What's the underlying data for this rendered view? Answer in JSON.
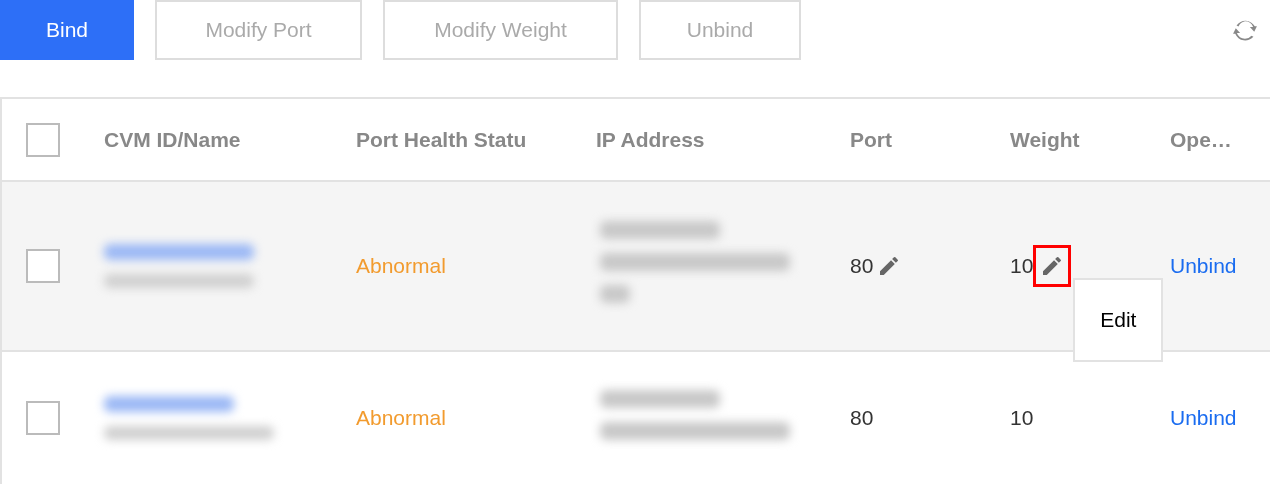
{
  "toolbar": {
    "buttons": [
      {
        "label": "Bind",
        "kind": "primary",
        "disabled": false
      },
      {
        "label": "Modify Port",
        "kind": "default",
        "disabled": true
      },
      {
        "label": "Modify Weight",
        "kind": "default",
        "disabled": true
      },
      {
        "label": "Unbind",
        "kind": "default",
        "disabled": true
      }
    ]
  },
  "table": {
    "columns": [
      "CVM ID/Name",
      "Port Health Statu",
      "IP Address",
      "Port",
      "Weight",
      "Ope…"
    ],
    "header_checked": false,
    "rows": [
      {
        "hovered": true,
        "checked": false,
        "status": "Abnormal",
        "port": "80",
        "weight": "10",
        "action": "Unbind",
        "edit_highlighted": true,
        "tooltip": "Edit"
      },
      {
        "hovered": false,
        "checked": false,
        "status": "Abnormal",
        "port": "80",
        "weight": "10",
        "action": "Unbind",
        "edit_highlighted": false
      }
    ]
  }
}
